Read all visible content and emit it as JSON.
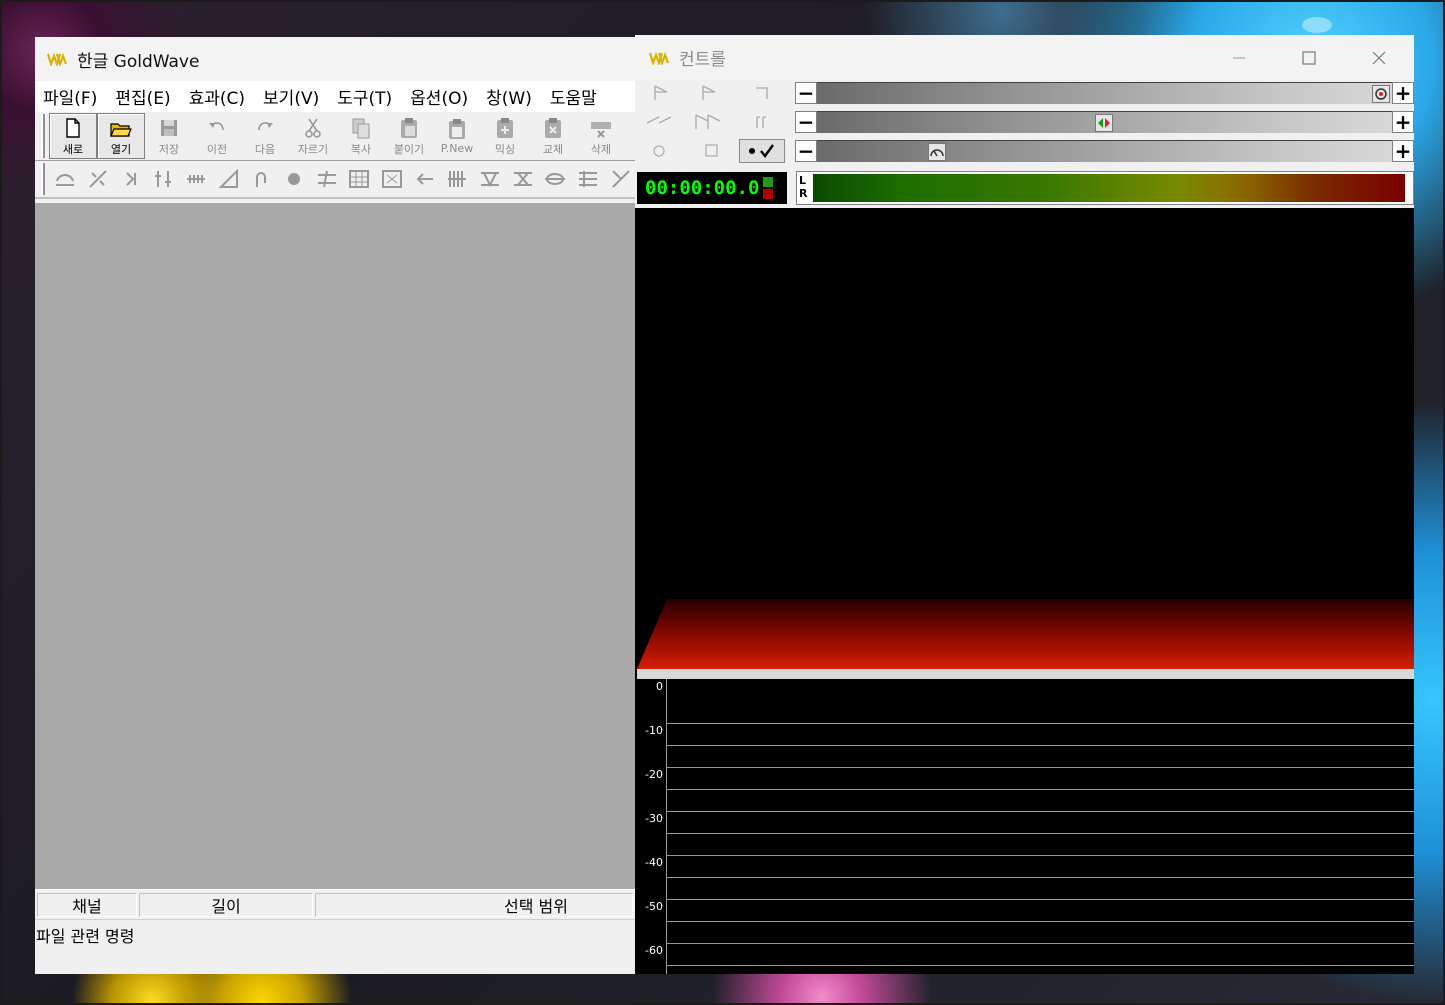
{
  "main_window": {
    "title": "한글 GoldWave",
    "menu": [
      "파일(F)",
      "편집(E)",
      "효과(C)",
      "보기(V)",
      "도구(T)",
      "옵션(O)",
      "창(W)",
      "도움말"
    ],
    "toolbar": [
      {
        "label": "새로",
        "icon": "new-file-icon",
        "active": true
      },
      {
        "label": "열기",
        "icon": "open-folder-icon",
        "active": true
      },
      {
        "label": "저장",
        "icon": "save-icon",
        "active": false
      },
      {
        "label": "이전",
        "icon": "undo-icon",
        "active": false
      },
      {
        "label": "다음",
        "icon": "redo-icon",
        "active": false
      },
      {
        "label": "자르기",
        "icon": "cut-icon",
        "active": false
      },
      {
        "label": "복사",
        "icon": "copy-icon",
        "active": false
      },
      {
        "label": "붙이기",
        "icon": "paste-icon",
        "active": false
      },
      {
        "label": "P.New",
        "icon": "paste-new-icon",
        "active": false
      },
      {
        "label": "믹싱",
        "icon": "mix-icon",
        "active": false
      },
      {
        "label": "교체",
        "icon": "replace-icon",
        "active": false
      },
      {
        "label": "삭제",
        "icon": "delete-icon",
        "active": false
      }
    ],
    "effects_toolbar": [
      "doppler-icon",
      "dynamics-icon",
      "echo-icon",
      "equalizer-icon",
      "filter-icon",
      "fade-icon",
      "flanger-icon",
      "invert-icon",
      "mechanize-icon",
      "offset-icon",
      "pitch-icon",
      "playback-rate-icon",
      "reverse-icon",
      "resample-icon",
      "silence-icon",
      "stereo-icon",
      "time-warp-icon",
      "volume-icon"
    ],
    "status": {
      "channel": "채널",
      "length": "길이",
      "selection": "선택 범위"
    },
    "hint": "파일 관련 명령"
  },
  "control_window": {
    "title": "컨트롤",
    "time": "00:00:00.0",
    "meter_labels": {
      "left": "L",
      "right": "R"
    },
    "volume_slider_value": 1.0,
    "balance_slider_value": 0.5,
    "speed_slider_value": 0.2,
    "db_scale": [
      "0",
      "-10",
      "-20",
      "-30",
      "-40",
      "-50",
      "-60"
    ]
  }
}
